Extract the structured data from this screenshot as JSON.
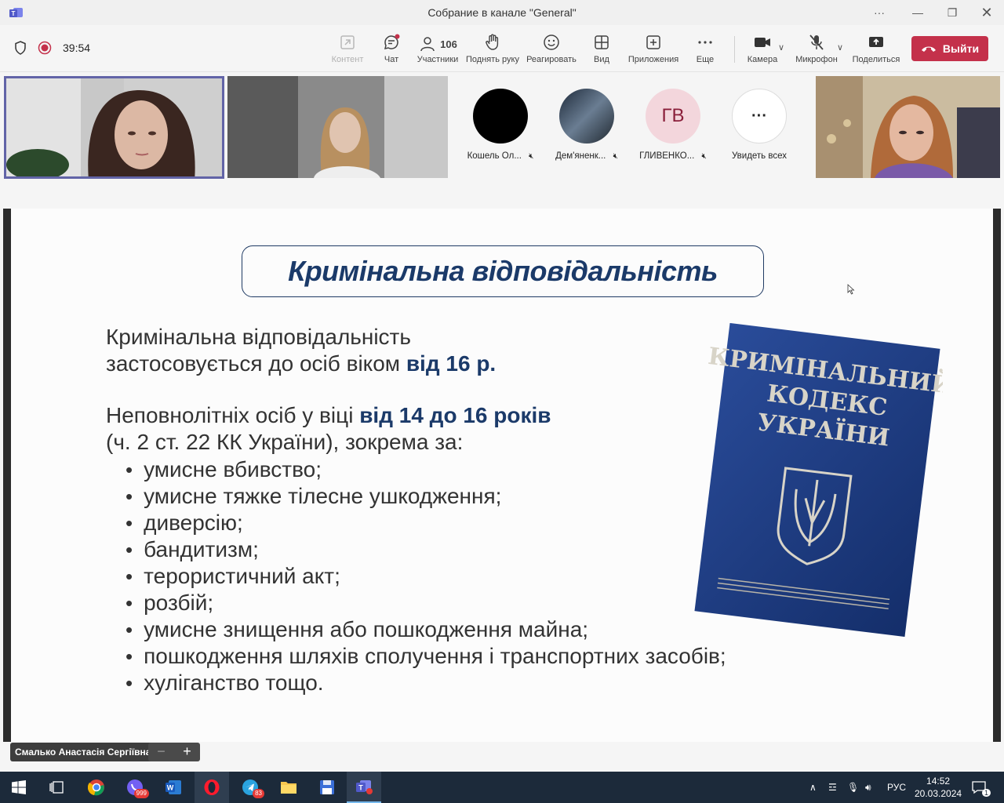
{
  "window": {
    "title": "Собрание в канале \"General\"",
    "more": "···"
  },
  "meeting": {
    "timer": "39:54"
  },
  "toolbar": {
    "content": "Контент",
    "chat": "Чат",
    "participants": "Участники",
    "participants_count": "106",
    "raise_hand": "Поднять руку",
    "react": "Реагировать",
    "view": "Вид",
    "apps": "Приложения",
    "more": "Еще",
    "camera": "Камера",
    "mic": "Микрофон",
    "share": "Поделиться",
    "leave": "Выйти"
  },
  "participants": [
    {
      "name": "Кошель Ол...",
      "initials": ""
    },
    {
      "name": "Дем'яненк...",
      "initials": ""
    },
    {
      "name": "ГЛИВЕНКО...",
      "initials": "ГВ"
    },
    {
      "name": "Увидеть всех",
      "initials": "···"
    }
  ],
  "slide": {
    "title": "Кримінальна відповідальність",
    "p1_line1": "Кримінальна відповідальність",
    "p1_line2_pre": "застосовується до осіб віком ",
    "p1_line2_bold": "від 16 р.",
    "p2_line1_pre": "Неповнолітніх осіб у віці ",
    "p2_line1_bold": "від 14 до 16 років",
    "p2_line2": "(ч. 2 ст. 22 КК України), зокрема за:",
    "bullets": [
      "умисне вбивство;",
      "умисне тяжке тілесне ушкодження;",
      "диверсію;",
      "бандитизм;",
      "терористичний акт;",
      "розбій;",
      "умисне знищення або пошкодження майна;",
      "пошкодження шляхів сполучення і транспортних засобів;",
      "хуліганство тощо."
    ],
    "book_line1": "КРИМІНАЛЬНИЙ",
    "book_line2": "КОДЕКС",
    "book_line3": "УКРАЇНИ"
  },
  "presenter": {
    "name": "Смалько Анастасія Сергіївна",
    "zoom_out": "−",
    "zoom_in": "+"
  },
  "taskbar": {
    "viber_badge": "999",
    "telegram_badge": "83",
    "lang": "РУС",
    "time": "14:52",
    "date": "20.03.2024",
    "notifications": "1"
  }
}
